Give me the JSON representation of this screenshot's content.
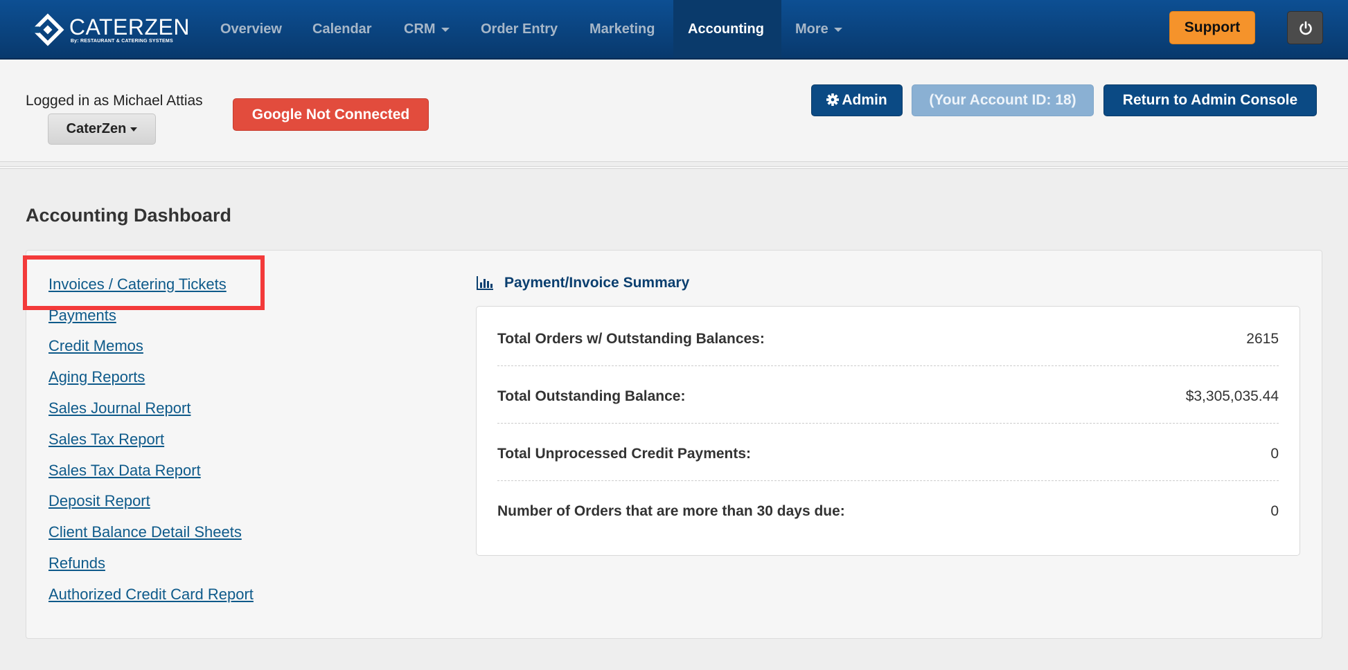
{
  "brand": {
    "name": "CATERZEN",
    "sub": "By: RESTAURANT & CATERING SYSTEMS"
  },
  "nav": {
    "items": [
      {
        "label": "Overview"
      },
      {
        "label": "Calendar"
      },
      {
        "label": "CRM"
      },
      {
        "label": "Order Entry"
      },
      {
        "label": "Marketing"
      },
      {
        "label": "Accounting"
      },
      {
        "label": "More"
      }
    ],
    "active": "Accounting",
    "support_label": "Support",
    "power_icon": "power-icon"
  },
  "header": {
    "logged_in_text": "Logged in as Michael Attias",
    "company_dropdown": "CaterZen",
    "google_status": "Google Not Connected",
    "admin_label": "Admin",
    "account_id_label": "(Your Account ID: 18)",
    "return_label": "Return to Admin Console"
  },
  "page": {
    "title": "Accounting Dashboard"
  },
  "links": [
    "Invoices / Catering Tickets",
    "Payments",
    "Credit Memos",
    "Aging Reports",
    "Sales Journal Report",
    "Sales Tax Report",
    "Sales Tax Data Report",
    "Deposit Report",
    "Client Balance Detail Sheets",
    "Refunds",
    "Authorized Credit Card Report"
  ],
  "summary": {
    "title": "Payment/Invoice Summary",
    "rows": [
      {
        "label": "Total Orders w/ Outstanding Balances:",
        "value": "2615"
      },
      {
        "label": "Total Outstanding Balance:",
        "value": "$3,305,035.44"
      },
      {
        "label": "Total Unprocessed Credit Payments:",
        "value": "0"
      },
      {
        "label": "Number of Orders that are more than 30 days due:",
        "value": "0"
      }
    ]
  },
  "colors": {
    "navbar": "#0b4a84",
    "support": "#f5932b",
    "google_badge": "#e24c3d",
    "link": "#0e5a8a",
    "highlight": "#f33a3a"
  }
}
